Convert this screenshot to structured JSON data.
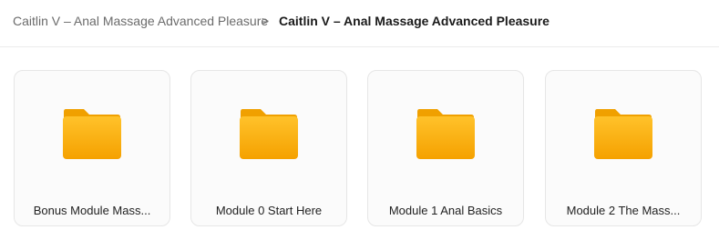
{
  "breadcrumb": {
    "parent": "Caitlin V – Anal Massage Advanced Pleasure",
    "separator": ">",
    "current": "Caitlin V – Anal Massage Advanced Pleasure"
  },
  "folders": [
    {
      "label": "Bonus Module Mass..."
    },
    {
      "label": "Module 0 Start Here"
    },
    {
      "label": "Module 1 Anal Basics"
    },
    {
      "label": "Module 2 The Mass..."
    }
  ],
  "colors": {
    "folder_top": "#FFC22A",
    "folder_bottom": "#F5A100",
    "folder_tab": "#F0A000"
  }
}
